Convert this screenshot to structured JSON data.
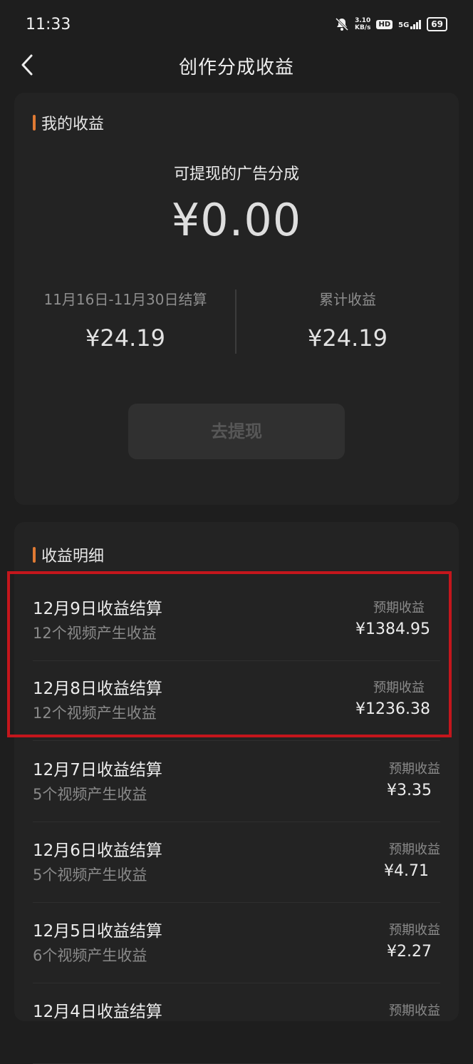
{
  "status_bar": {
    "time": "11:33",
    "net_speed_value": "3.10",
    "net_speed_unit": "KB/s",
    "hd": "HD",
    "network": "5G",
    "battery": "69"
  },
  "header": {
    "title": "创作分成收益"
  },
  "my_earnings": {
    "title": "我的收益",
    "available_label": "可提现的广告分成",
    "available_amount": "¥0.00",
    "period_label": "11月16日-11月30日结算",
    "period_amount": "¥24.19",
    "total_label": "累计收益",
    "total_amount": "¥24.19",
    "withdraw_button": "去提现"
  },
  "details": {
    "title": "收益明细",
    "items": [
      {
        "title": "12月9日收益结算",
        "subtitle": "12个视频产生收益",
        "label": "预期收益",
        "amount": "¥1384.95"
      },
      {
        "title": "12月8日收益结算",
        "subtitle": "12个视频产生收益",
        "label": "预期收益",
        "amount": "¥1236.38"
      },
      {
        "title": "12月7日收益结算",
        "subtitle": "5个视频产生收益",
        "label": "预期收益",
        "amount": "¥3.35"
      },
      {
        "title": "12月6日收益结算",
        "subtitle": "5个视频产生收益",
        "label": "预期收益",
        "amount": "¥4.71"
      },
      {
        "title": "12月5日收益结算",
        "subtitle": "6个视频产生收益",
        "label": "预期收益",
        "amount": "¥2.27"
      },
      {
        "title": "12月4日收益结算",
        "subtitle": "",
        "label": "预期收益",
        "amount": ""
      }
    ]
  },
  "colors": {
    "background": "#1e1e1e",
    "card": "#232323",
    "accent": "#e07a33",
    "highlight_border": "#c4161c"
  }
}
